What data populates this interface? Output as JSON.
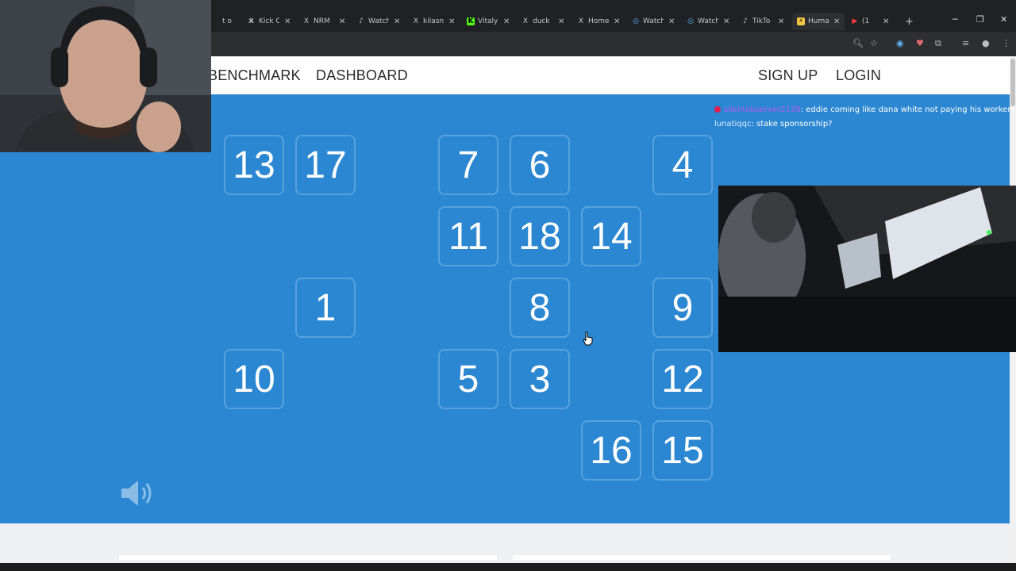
{
  "browser": {
    "tabs": [
      {
        "icon": "generic-tab-icon",
        "label": "t o"
      },
      {
        "icon": "x-logo-icon",
        "label": "Kick C"
      },
      {
        "icon": "x-logo-icon",
        "label": "NRM"
      },
      {
        "icon": "tiktok-icon",
        "label": "Watch"
      },
      {
        "icon": "x-logo-icon",
        "label": "kilasn"
      },
      {
        "icon": "kick-icon",
        "label": "Vitaly"
      },
      {
        "icon": "x-logo-icon",
        "label": "duck"
      },
      {
        "icon": "x-logo-icon",
        "label": "Home"
      },
      {
        "icon": "globe-icon",
        "label": "Watch"
      },
      {
        "icon": "globe-icon",
        "label": "Watch"
      },
      {
        "icon": "tiktok-icon",
        "label": "TikTo"
      },
      {
        "icon": "humanbenchmark-icon",
        "label": "Huma",
        "active": true
      },
      {
        "icon": "youtube-icon",
        "label": "(1"
      }
    ],
    "new_tab_label": "+"
  },
  "site_nav": {
    "brand": "BENCHMARK",
    "dashboard": "DASHBOARD",
    "signup": "SIGN UP",
    "login": "LOGIN"
  },
  "tiles": [
    "13",
    "17",
    "7",
    "6",
    "4",
    "11",
    "18",
    "14",
    "1",
    "8",
    "9",
    "10",
    "5",
    "3",
    "12",
    "16",
    "15"
  ],
  "chat": [
    {
      "user": "silentobserver2139",
      "msg": ": eddie coming like dana white not paying his workers",
      "badge": true
    },
    {
      "user": "lunatiqqc",
      "msg": ": stake sponsorship?",
      "badge": false
    }
  ],
  "colors": {
    "game_bg": "#2b87d1",
    "nav_bg": "#ffffff",
    "tile_text": "#ffffff",
    "chat_username": "#b45cf0"
  }
}
